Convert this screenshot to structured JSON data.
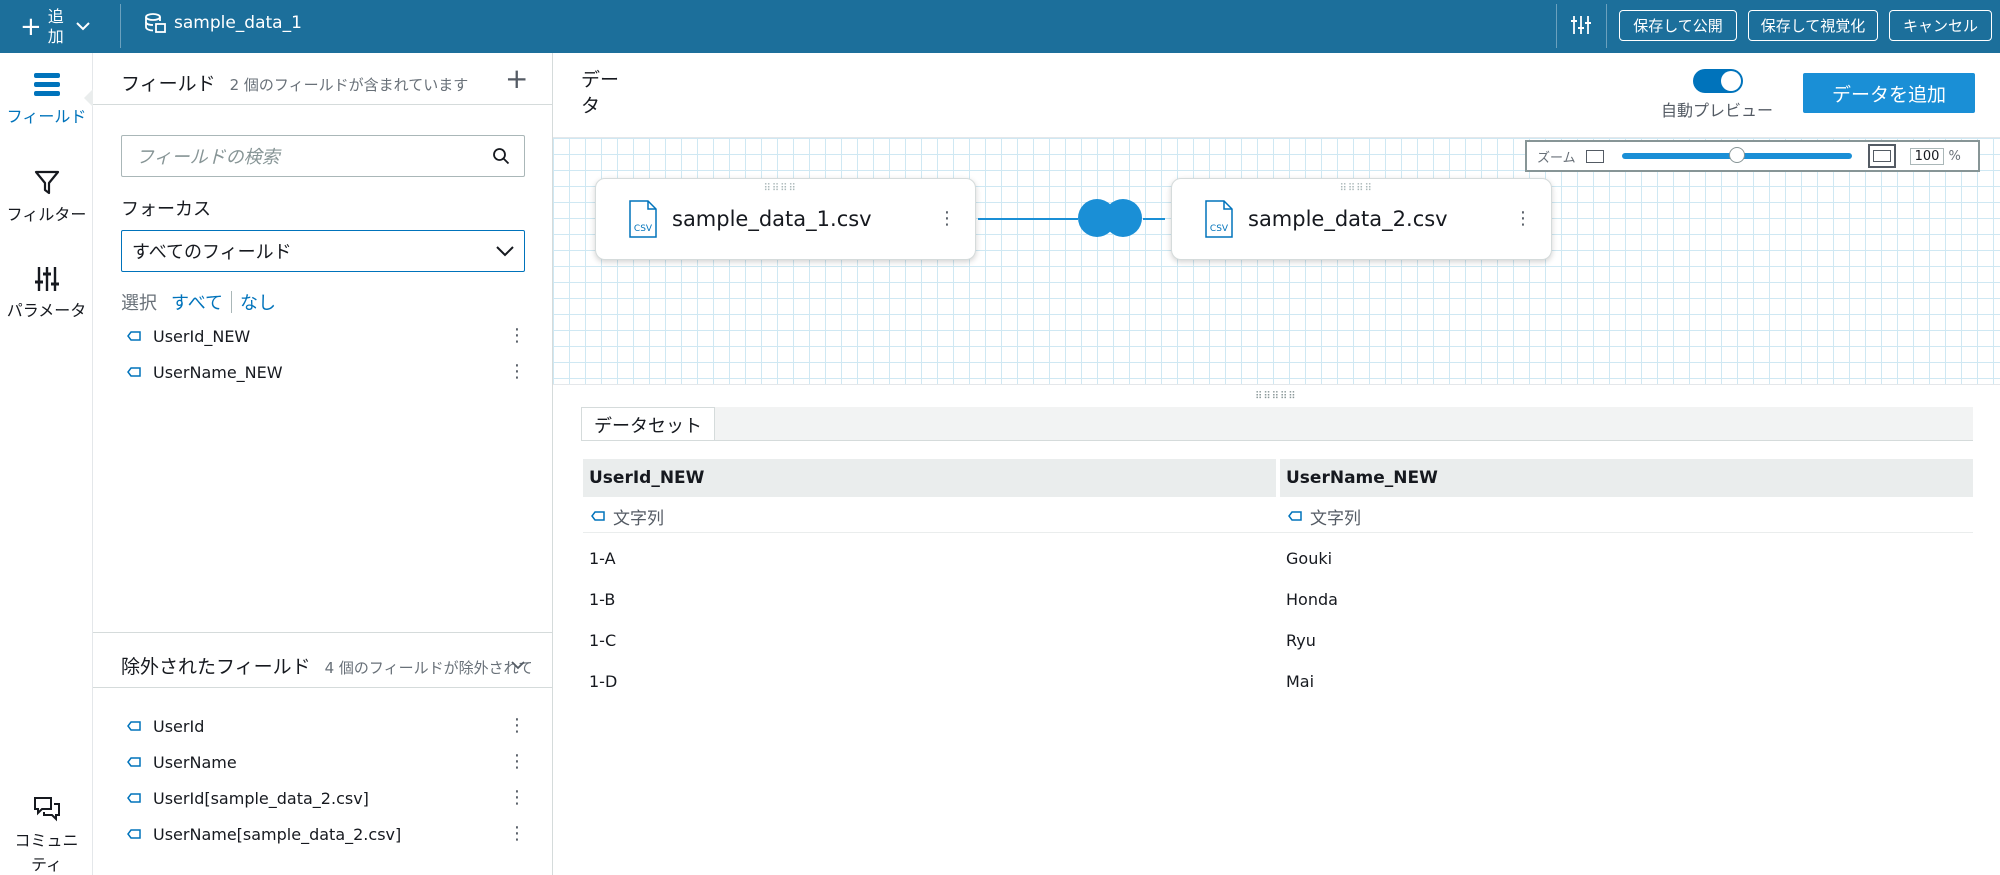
{
  "topbar": {
    "add_label": "追加",
    "dataset_name": "sample_data_1",
    "publish_button": "保存して公開",
    "visualize_button": "保存して視覚化",
    "cancel_button": "キャンセル"
  },
  "rail": {
    "fields": "フィールド",
    "filter": "フィルター",
    "parameters": "パラメータ",
    "community": "コミュニティ"
  },
  "fields_panel": {
    "title": "フィールド",
    "subtitle": "2 個のフィールドが含まれています",
    "search_placeholder": "フィールドの検索",
    "focus_label": "フォーカス",
    "focus_value": "すべてのフィールド",
    "select_label": "選択",
    "select_all": "すべて",
    "select_none": "なし",
    "fields": [
      "UserId_NEW",
      "UserName_NEW"
    ],
    "excluded_title": "除外されたフィールド",
    "excluded_subtitle": "4 個のフィールドが除外されて",
    "excluded_fields": [
      "UserId",
      "UserName",
      "UserId[sample_data_2.csv]",
      "UserName[sample_data_2.csv]"
    ]
  },
  "main": {
    "title": "データ",
    "auto_preview_label": "自動プレビュー",
    "auto_preview_on": true,
    "add_data_button": "データを追加",
    "zoom_label": "ズーム",
    "zoom_value": "100",
    "zoom_unit": "%",
    "nodes": [
      {
        "name": "sample_data_1.csv",
        "icon_text": "CSV"
      },
      {
        "name": "sample_data_2.csv",
        "icon_text": "CSV"
      }
    ],
    "tab_label": "データセット"
  },
  "table": {
    "columns": [
      {
        "name": "UserId_NEW",
        "type": "文字列"
      },
      {
        "name": "UserName_NEW",
        "type": "文字列"
      }
    ],
    "rows": [
      [
        "1-A",
        "Gouki"
      ],
      [
        "1-B",
        "Honda"
      ],
      [
        "1-C",
        "Ryu"
      ],
      [
        "1-D",
        "Mai"
      ]
    ]
  },
  "colors": {
    "topbar": "#1c6f9b",
    "accent": "#0073bb",
    "join": "#1a8fd6"
  }
}
